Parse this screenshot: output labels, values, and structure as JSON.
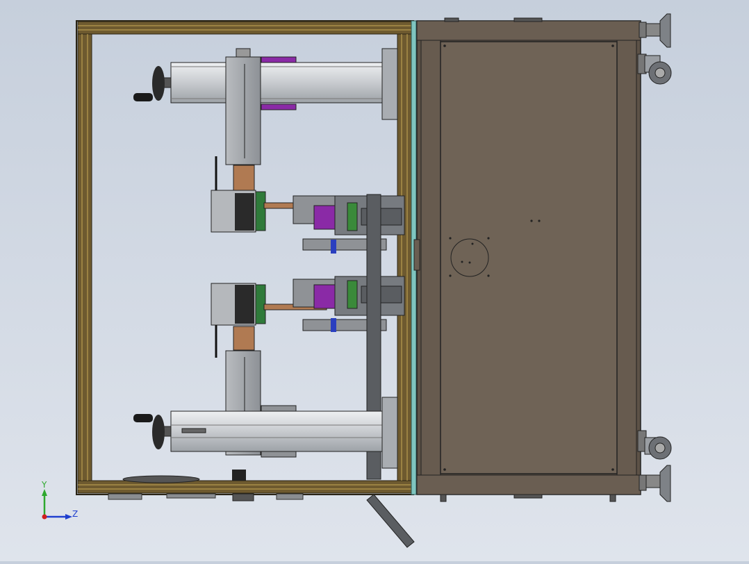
{
  "colors": {
    "background_top": "#c6cfdc",
    "background_bottom": "#dfe4ec",
    "frame_profile": "#6e5a2f",
    "frame_dark": "#2a2416",
    "cabinet_panel": "#6f6356",
    "cabinet_frame": "#5d5247",
    "glass_panel": "#7fc6c0",
    "gripper_purple": "#8a2aa6",
    "copper_rod": "#b07a52",
    "green_part": "#3a8a3a",
    "blue_part": "#2a3fbf",
    "triad_y": "#2ea82e",
    "triad_z": "#1f3fcf",
    "triad_x": "#cf1f1f"
  },
  "triad": {
    "y_label": "Y",
    "z_label": "Z",
    "icon": "coordinate-triad-icon"
  }
}
